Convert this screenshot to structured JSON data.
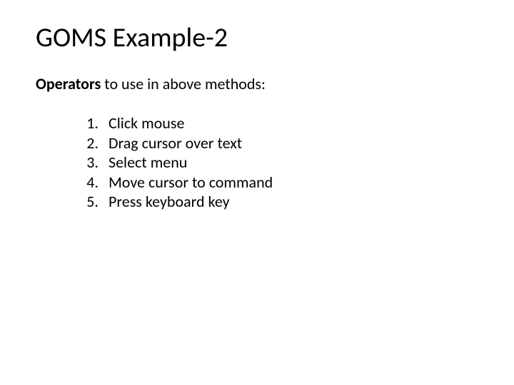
{
  "title": "GOMS Example-2",
  "subtitle": {
    "bold": "Operators",
    "rest": " to use in above methods:"
  },
  "operators": [
    {
      "num": "1.",
      "text": "Click mouse"
    },
    {
      "num": "2.",
      "text": "Drag cursor over text"
    },
    {
      "num": "3.",
      "text": "Select menu"
    },
    {
      "num": "4.",
      "text": "Move cursor to command"
    },
    {
      "num": "5.",
      "text": "Press keyboard key"
    }
  ]
}
